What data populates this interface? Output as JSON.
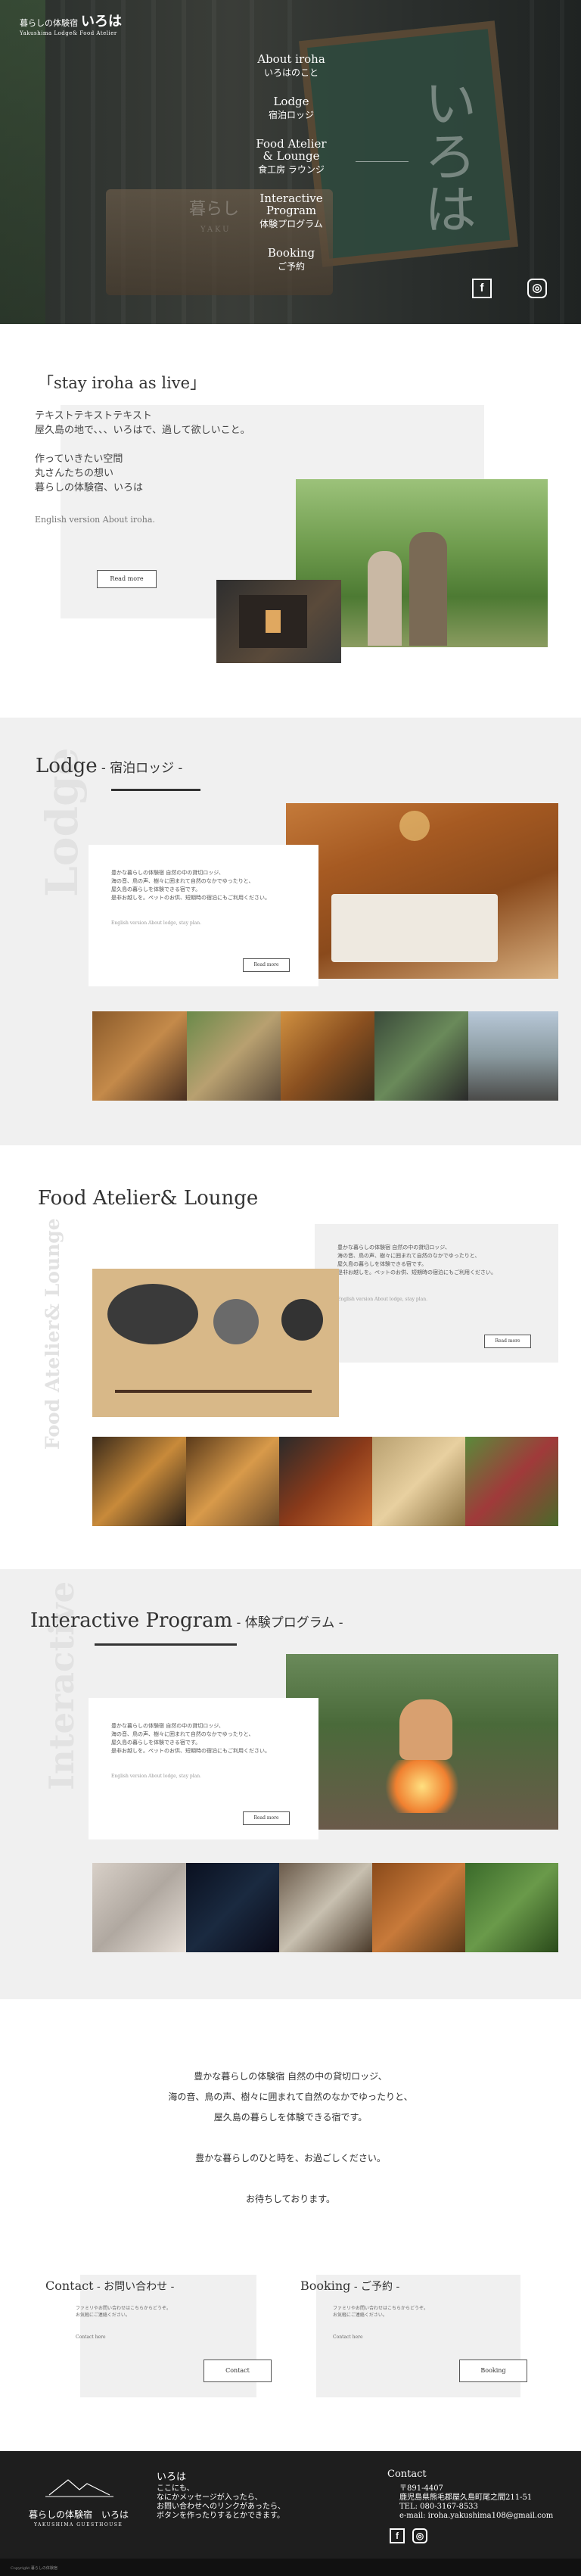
{
  "header": {
    "logo_small": "暮らしの体験宿",
    "logo_main": "いろは",
    "logo_sub": "Yakushima Lodge& Food Atelier"
  },
  "hero": {
    "board_text": "いろは",
    "faded_text": "暮らし",
    "faded_text_2": "YAKU"
  },
  "nav": [
    {
      "en": "About iroha",
      "jp": "いろはのこと"
    },
    {
      "en": "Lodge",
      "jp": "宿泊ロッジ"
    },
    {
      "en": "Food Atelier",
      "en2": "& Lounge",
      "jp": "食工房 ラウンジ"
    },
    {
      "en": "Interactive",
      "en2": "Program",
      "jp": "体験プログラム"
    },
    {
      "en": "Booking",
      "jp": "ご予約"
    }
  ],
  "social": {
    "facebook": "f",
    "instagram": "◎"
  },
  "about": {
    "title": "「stay iroha as live」",
    "text_lines": [
      "テキストテキストテキスト",
      "屋久島の地で、、、いろはで、過して欲しいこと。",
      "",
      "作っていきたい空間",
      "丸さんたちの想い",
      "暮らしの体験宿、いろは"
    ],
    "english_link": "English version About iroha.",
    "read_more": "Read more"
  },
  "lodge": {
    "title": "Lodge",
    "title_jp": " - 宿泊ロッジ -",
    "vertical": "Lodge",
    "card_text": [
      "豊かな暮らしの体験宿 自然の中の貸切ロッジ、",
      "海の音、鳥の声、樹々に囲まれて自然のなかでゆったりと、",
      "屋久島の暮らしを体験できる宿です。",
      "是非お越しを。ペットのお供、短期時の宿泊にもご利用ください。"
    ],
    "english_link": "English version About lodge, stay plan.",
    "read_more": "Read more"
  },
  "food": {
    "title": "Food Atelier& Lounge",
    "vertical": "Food Atelier& Lounge",
    "card_text": [
      "豊かな暮らしの体験宿 自然の中の貸切ロッジ、",
      "海の音、鳥の声、樹々に囲まれて自然のなかでゆったりと、",
      "屋久島の暮らしを体験できる宿です。",
      "是非お越しを。ペットのお供、短期時の宿泊にもご利用ください。"
    ],
    "english_link": "English version About lodge, stay plan.",
    "read_more": "Read more"
  },
  "program": {
    "title": "Interactive Program",
    "title_jp": " - 体験プログラム -",
    "vertical": "Interactive",
    "card_text": [
      "豊かな暮らしの体験宿 自然の中の貸切ロッジ、",
      "海の音、鳥の声、樹々に囲まれて自然のなかでゆったりと、",
      "屋久島の暮らしを体験できる宿です。",
      "是非お越しを。ペットのお供、短期時の宿泊にもご利用ください。"
    ],
    "english_link": "English version About lodge, stay plan.",
    "read_more": "Read more"
  },
  "message": {
    "lines": [
      "豊かな暮らしの体験宿 自然の中の貸切ロッジ、",
      "海の音、鳥の声、樹々に囲まれて自然のなかでゆったりと、",
      "屋久島の暮らしを体験できる宿です。",
      "",
      "豊かな暮らしのひと時を、お過ごしください。",
      "",
      "お待ちしております。"
    ]
  },
  "contact": {
    "title": "Contact",
    "title_jp": " - お問い合わせ -",
    "text": [
      "ファミリやお問い合わせはこちらからどうぞ。",
      "お気軽にご連絡ください。"
    ],
    "small": "Contact here",
    "button": "Contact"
  },
  "booking": {
    "title": "Booking",
    "title_jp": " - ご予約 -",
    "text": [
      "ファミリやお問い合わせはこちらからどうぞ。",
      "お気軽にご連絡ください。"
    ],
    "small": "Contact here",
    "button": "Booking"
  },
  "footer": {
    "logo_text": "暮らしの体験宿　いろは",
    "logo_sub": "YAKUSHIMA GUESTHOUSE",
    "iroha_title": "いろは",
    "iroha_text": [
      "ここにも、",
      "なにかメッセージが入ったら、",
      "お問い合わせへのリンクがあったら、",
      "ボタンを作ったりするとかできます。"
    ],
    "contact_title": "Contact",
    "contact_lines": [
      "〒891-4407",
      "鹿児島県熊毛郡屋久島町尾之間211-51",
      "TEL: 080-3167-8533",
      "e-mail: iroha.yakushima108@gmail.com"
    ],
    "copyright": "Copyright 暮らしの体験宿"
  }
}
